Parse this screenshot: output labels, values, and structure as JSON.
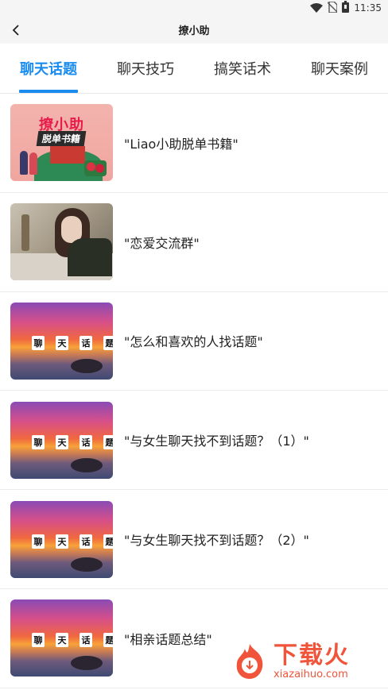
{
  "status_bar": {
    "time": "11:35"
  },
  "header": {
    "title": "撩小助"
  },
  "tabs": [
    {
      "label": "聊天话题",
      "active": true
    },
    {
      "label": "聊天技巧",
      "active": false
    },
    {
      "label": "搞笑话术",
      "active": false
    },
    {
      "label": "聊天案例",
      "active": false
    }
  ],
  "list": [
    {
      "label": "\"Liao小助脱单书籍\"",
      "thumb": "book-cover",
      "thumb_title": "撩小助",
      "thumb_sub": "脱单书籍"
    },
    {
      "label": "\"恋爱交流群\"",
      "thumb": "photo"
    },
    {
      "label": "\"怎么和喜欢的人找话题\"",
      "thumb": "sunset",
      "tags": [
        "聊",
        "天",
        "话",
        "题"
      ]
    },
    {
      "label": "\"与女生聊天找不到话题？（1）\"",
      "thumb": "sunset",
      "tags": [
        "聊",
        "天",
        "话",
        "题"
      ]
    },
    {
      "label": "\"与女生聊天找不到话题？（2）\"",
      "thumb": "sunset",
      "tags": [
        "聊",
        "天",
        "话",
        "题"
      ]
    },
    {
      "label": "\"相亲话题总结\"",
      "thumb": "sunset",
      "tags": [
        "聊",
        "天",
        "话",
        "题"
      ]
    }
  ],
  "watermark": {
    "name": "下载火",
    "domain": "xiazaihuo.com"
  },
  "colors": {
    "accent": "#1a8cf0",
    "watermark": "#f0543a"
  }
}
